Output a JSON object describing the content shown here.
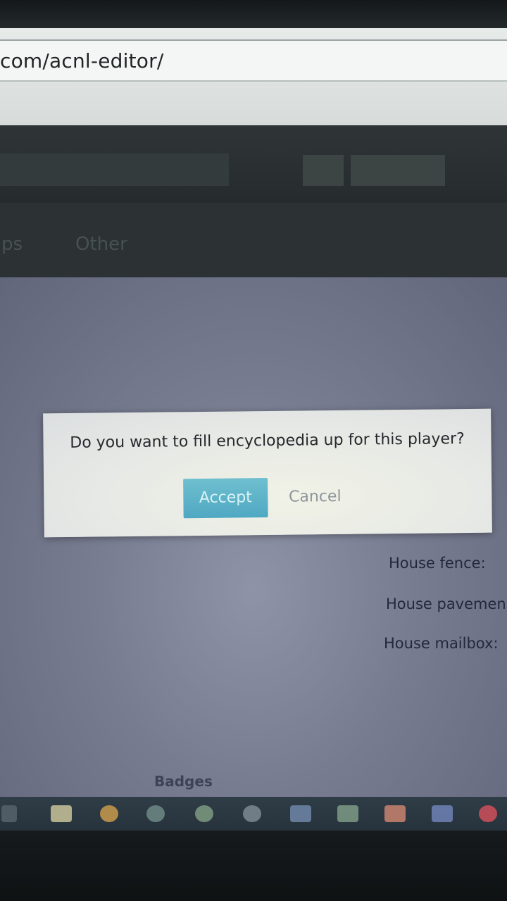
{
  "browser": {
    "url": "com/acnl-editor/"
  },
  "nav": {
    "tabs": [
      "ps",
      "Other"
    ]
  },
  "form": {
    "labels": [
      "House fence:",
      "House pavemen",
      "House mailbox:"
    ],
    "section_title": "Badges"
  },
  "dialog": {
    "message": "Do you want to fill encyclopedia up for this player?",
    "accept_label": "Accept",
    "cancel_label": "Cancel"
  },
  "colors": {
    "accent": "#5aaec7",
    "dialog_bg": "#e8ebe6",
    "taskbar_bg": "#2b3740"
  },
  "taskbar": {
    "icons": [
      "task-view-icon",
      "file-explorer-icon",
      "chrome-icon",
      "app-icon",
      "spotify-icon",
      "media-icon",
      "word-icon",
      "excel-icon",
      "powerpoint-icon",
      "visual-studio-icon",
      "gmail-icon"
    ]
  }
}
